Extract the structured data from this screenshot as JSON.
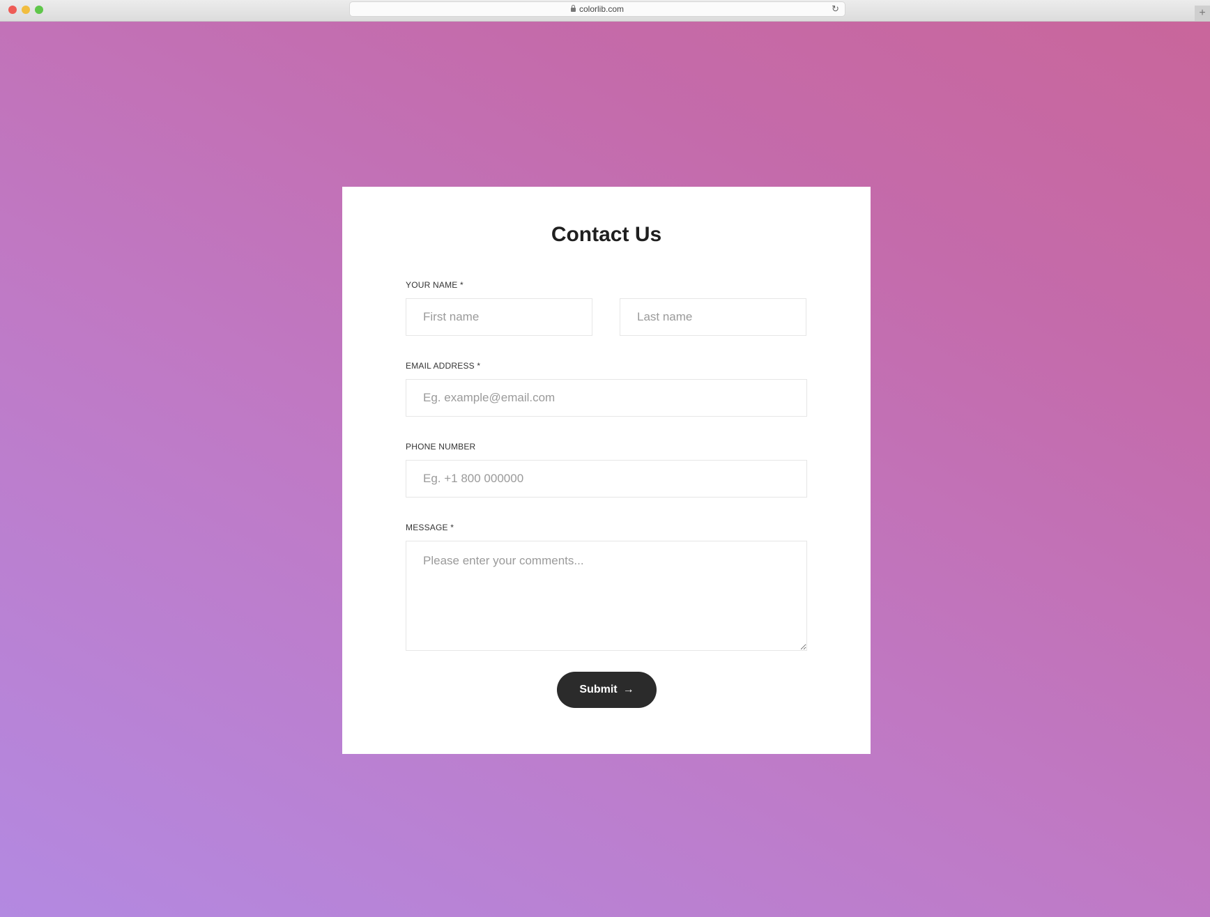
{
  "browser": {
    "url": "colorlib.com",
    "reload_icon": "reload-icon",
    "new_tab_icon": "plus-icon"
  },
  "form": {
    "title": "Contact Us",
    "name_label": "YOUR NAME *",
    "first_name_placeholder": "First name",
    "last_name_placeholder": "Last name",
    "email_label": "EMAIL ADDRESS *",
    "email_placeholder": "Eg. example@email.com",
    "phone_label": "PHONE NUMBER",
    "phone_placeholder": "Eg. +1 800 000000",
    "message_label": "MESSAGE *",
    "message_placeholder": "Please enter your comments...",
    "submit_label": "Submit",
    "submit_icon": "arrow-right-icon"
  },
  "colors": {
    "gradient_start": "#b389e1",
    "gradient_end": "#c9669b",
    "button": "#2b2b2b"
  }
}
